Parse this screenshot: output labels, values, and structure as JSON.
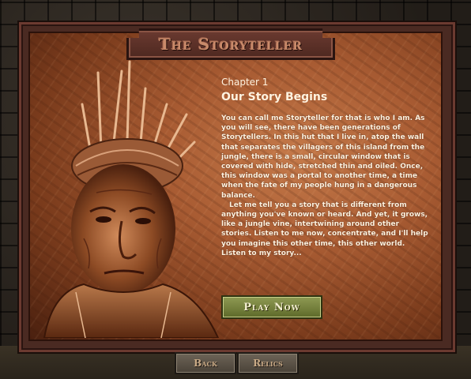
{
  "title": "The Storyteller",
  "chapter": {
    "number": "Chapter 1",
    "title": "Our Story Begins"
  },
  "story": {
    "paragraph1": "You can call me Storyteller for that is who I am. As you will see, there have been generations of Storytellers. In this hut that I live in, atop the wall that separates the villagers of this island from the jungle, there is a small, circular window that is covered with hide, stretched thin and oiled. Once, this window was a portal to another time, a time when the fate of my people hung in a dangerous balance.",
    "paragraph2": "Let me tell you a story that is different from anything you've known or heard. And yet, it grows, like a jungle vine, intertwining around other stories. Listen to me now, concentrate, and I'll help you imagine this other time, this other world. Listen to my story..."
  },
  "buttons": {
    "play": "Play Now",
    "back": "Back",
    "relics": "Relics"
  },
  "colors": {
    "parchment": "#a95c33",
    "frame": "#4a2a22",
    "play_button": "#7a8540",
    "nav_button": "#5a5248",
    "text": "#fff3e0"
  },
  "icons": {
    "portrait": "storyteller-portrait"
  }
}
